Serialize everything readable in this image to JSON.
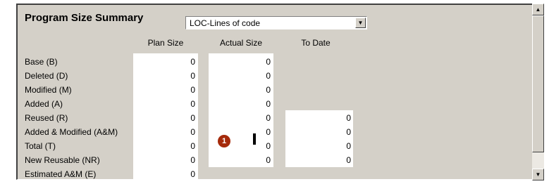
{
  "title": "Program Size Summary",
  "unit_select": {
    "value": "LOC-Lines of code",
    "arrow_icon": "chevron-down-icon"
  },
  "columns": {
    "plan": "Plan Size",
    "actual": "Actual Size",
    "to_date": "To Date"
  },
  "rows": [
    {
      "label": "Base (B)",
      "plan": "0",
      "actual": "0",
      "to_date": null
    },
    {
      "label": "Deleted (D)",
      "plan": "0",
      "actual": "0",
      "to_date": null
    },
    {
      "label": "Modified (M)",
      "plan": "0",
      "actual": "0",
      "to_date": null
    },
    {
      "label": "Added (A)",
      "plan": "0",
      "actual": "0",
      "to_date": null
    },
    {
      "label": "Reused (R)",
      "plan": "0",
      "actual": "0",
      "to_date": "0"
    },
    {
      "label": "Added & Modified (A&M)",
      "plan": "0",
      "actual": "0",
      "to_date": "0"
    },
    {
      "label": "Total (T)",
      "plan": "0",
      "actual": "0",
      "to_date": "0"
    },
    {
      "label": "New Reusable (NR)",
      "plan": "0",
      "actual": "0",
      "to_date": "0"
    },
    {
      "label": "Estimated A&M (E)",
      "plan": "0",
      "actual": null,
      "to_date": null
    }
  ],
  "marker": "1",
  "colors": {
    "panel_bg": "#d4d0c8",
    "marker_bg": "#a52a0a"
  },
  "scrollbar": {
    "up_icon": "scroll-up-icon",
    "down_icon": "scroll-down-icon"
  }
}
